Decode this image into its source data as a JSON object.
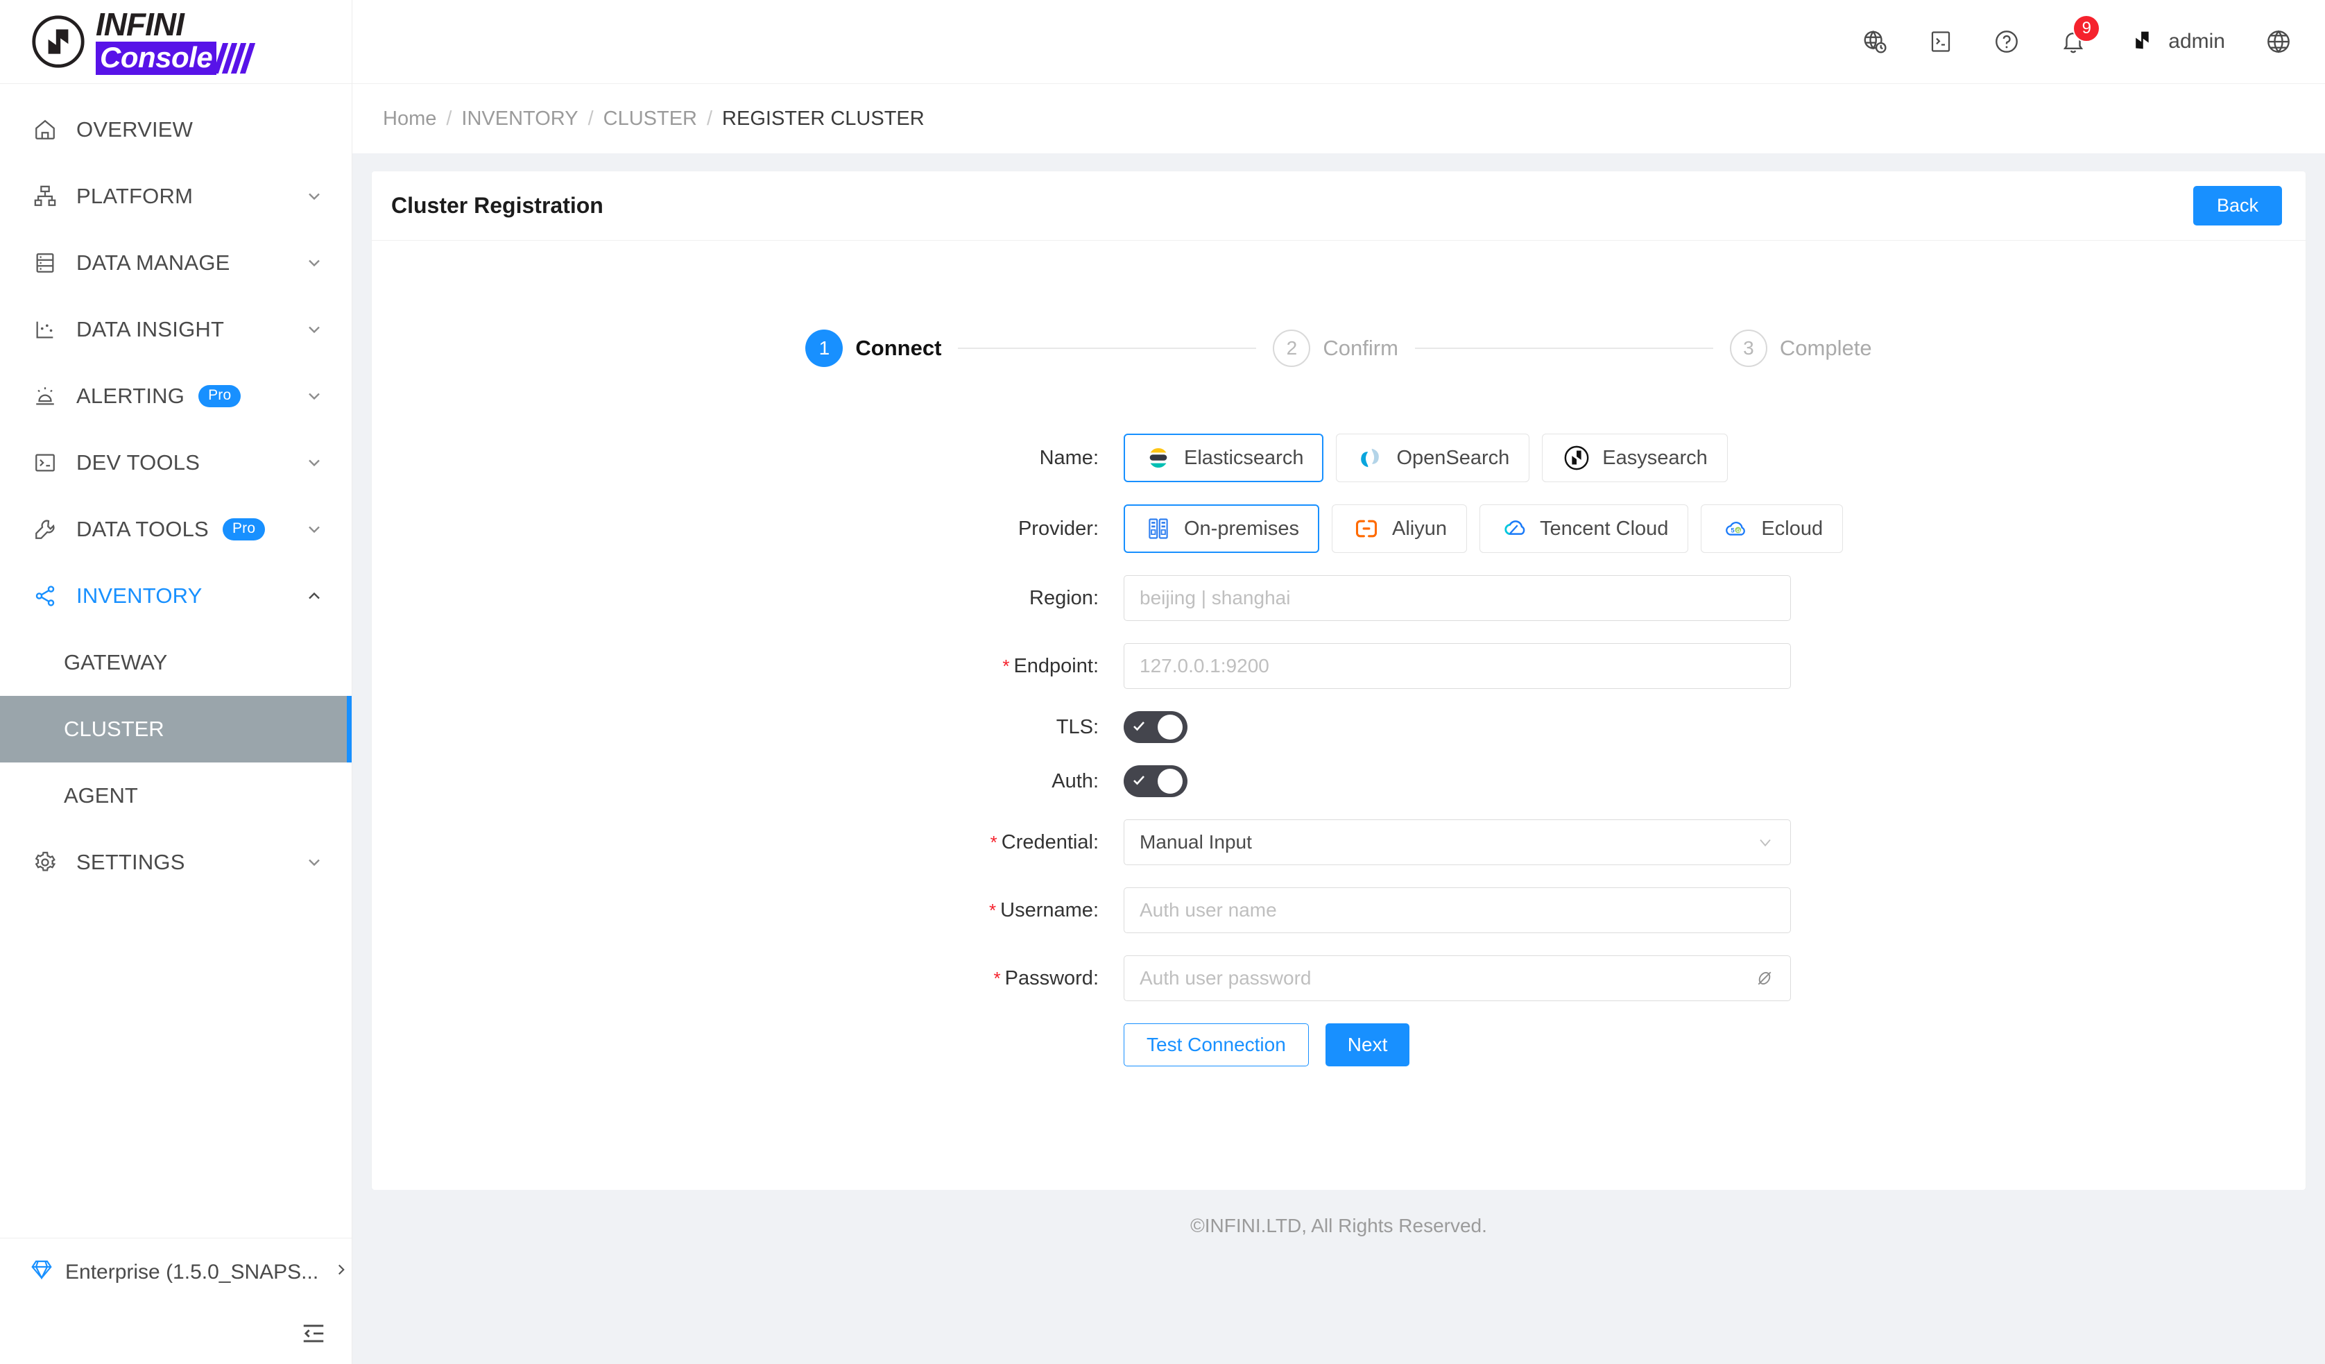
{
  "brand": {
    "line1": "INFINI",
    "line2": "Console"
  },
  "sidebar": {
    "items": [
      {
        "label": "OVERVIEW",
        "icon": "home-icon",
        "expandable": false
      },
      {
        "label": "PLATFORM",
        "icon": "platform-icon",
        "expandable": true
      },
      {
        "label": "DATA MANAGE",
        "icon": "database-icon",
        "expandable": true
      },
      {
        "label": "DATA INSIGHT",
        "icon": "chart-icon",
        "expandable": true
      },
      {
        "label": "ALERTING",
        "icon": "alarm-icon",
        "expandable": true,
        "badge": "Pro"
      },
      {
        "label": "DEV TOOLS",
        "icon": "terminal-icon",
        "expandable": true
      },
      {
        "label": "DATA TOOLS",
        "icon": "wrench-icon",
        "expandable": true,
        "badge": "Pro"
      },
      {
        "label": "INVENTORY",
        "icon": "share-icon",
        "expandable": true,
        "expanded": true,
        "active": true
      },
      {
        "label": "SETTINGS",
        "icon": "gear-icon",
        "expandable": true
      }
    ],
    "inventory_children": [
      {
        "label": "GATEWAY",
        "selected": false
      },
      {
        "label": "CLUSTER",
        "selected": true
      },
      {
        "label": "AGENT",
        "selected": false
      }
    ],
    "footer": {
      "label": "Enterprise (1.5.0_SNAPS...",
      "icon": "diamond-icon"
    },
    "collapse_icon": "collapse-sidebar-icon"
  },
  "topbar": {
    "icons": [
      "globe-clock-icon",
      "console-icon",
      "help-icon",
      "notification-bell-icon"
    ],
    "notification_count": "9",
    "user": "admin",
    "language_icon": "globe-icon"
  },
  "breadcrumb": {
    "items": [
      "Home",
      "INVENTORY",
      "CLUSTER",
      "REGISTER CLUSTER"
    ],
    "separator": "/"
  },
  "card": {
    "title": "Cluster Registration",
    "back_label": "Back"
  },
  "steps": [
    {
      "num": "1",
      "label": "Connect",
      "state": "done"
    },
    {
      "num": "2",
      "label": "Confirm",
      "state": "todo"
    },
    {
      "num": "3",
      "label": "Complete",
      "state": "todo"
    }
  ],
  "form": {
    "name": {
      "label": "Name",
      "options": [
        {
          "label": "Elasticsearch",
          "logo": "elasticsearch-logo",
          "selected": true
        },
        {
          "label": "OpenSearch",
          "logo": "opensearch-logo",
          "selected": false
        },
        {
          "label": "Easysearch",
          "logo": "easysearch-logo",
          "selected": false
        }
      ]
    },
    "provider": {
      "label": "Provider",
      "options": [
        {
          "label": "On-premises",
          "logo": "server-rack-icon",
          "selected": true
        },
        {
          "label": "Aliyun",
          "logo": "aliyun-logo",
          "selected": false
        },
        {
          "label": "Tencent Cloud",
          "logo": "tencent-cloud-logo",
          "selected": false
        },
        {
          "label": "Ecloud",
          "logo": "ecloud-logo",
          "selected": false
        }
      ]
    },
    "region": {
      "label": "Region",
      "placeholder": "beijing | shanghai",
      "value": "",
      "required": false
    },
    "endpoint": {
      "label": "Endpoint",
      "placeholder": "127.0.0.1:9200",
      "value": "",
      "required": true
    },
    "tls": {
      "label": "TLS",
      "checked": true
    },
    "auth": {
      "label": "Auth",
      "checked": true
    },
    "credential": {
      "label": "Credential",
      "value": "Manual Input",
      "required": true,
      "chevron": "chevron-down-icon"
    },
    "username": {
      "label": "Username",
      "placeholder": "Auth user name",
      "value": "",
      "required": true
    },
    "password": {
      "label": "Password",
      "placeholder": "Auth user password",
      "value": "",
      "required": true,
      "reveal_icon": "eye-off-icon"
    },
    "actions": {
      "test": "Test Connection",
      "next": "Next"
    }
  },
  "footer": {
    "text": "©INFINI.LTD, All Rights Reserved."
  }
}
